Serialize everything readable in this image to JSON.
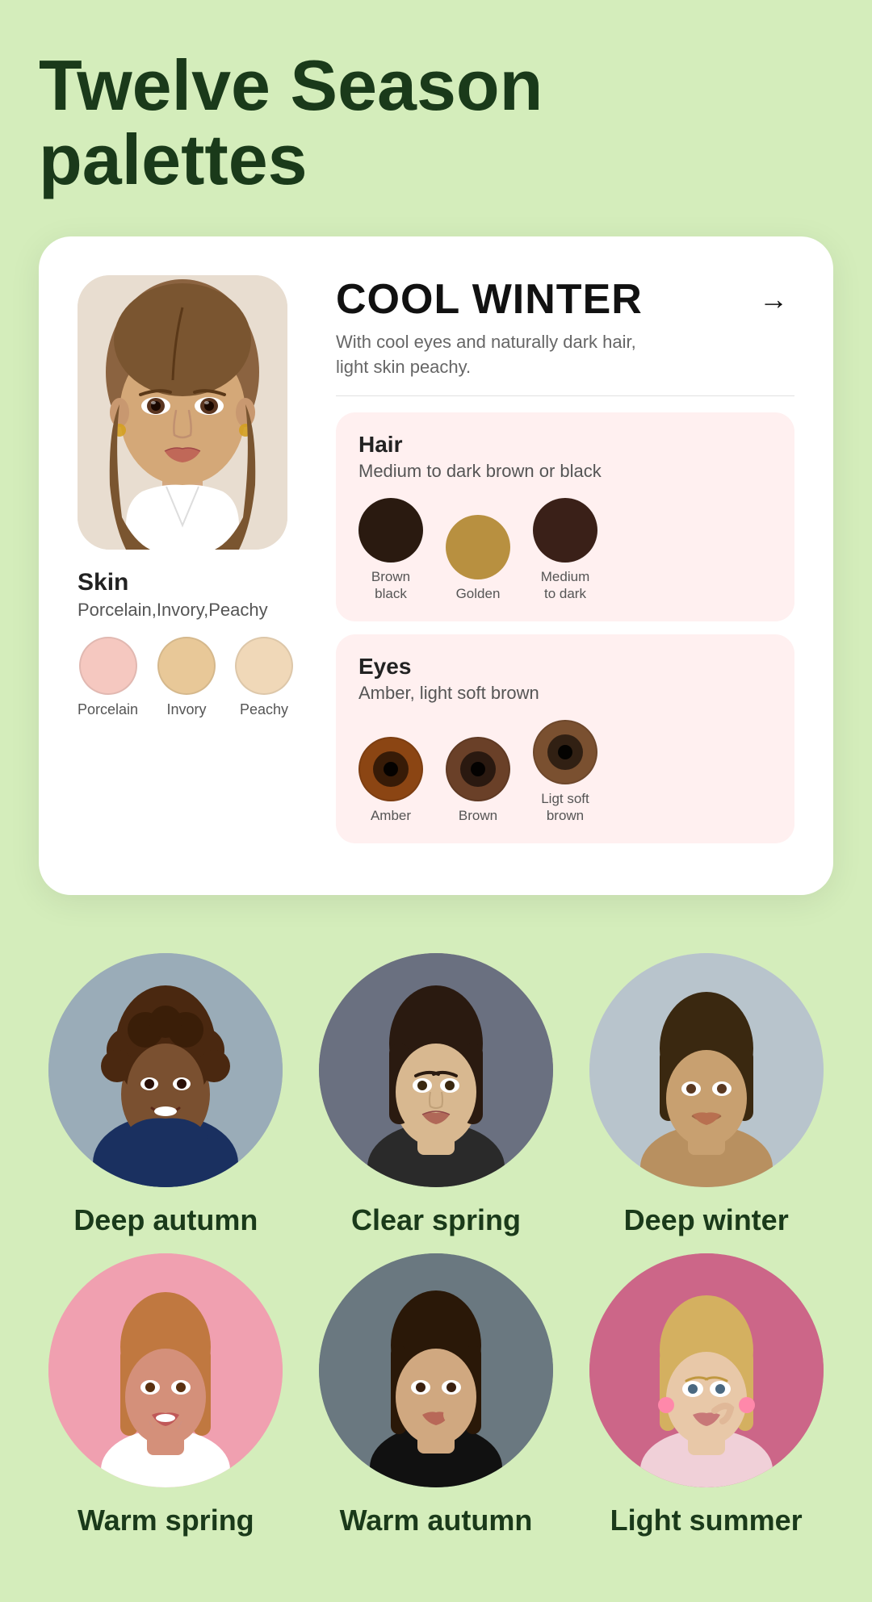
{
  "page": {
    "title": "Twelve Season\npalettes",
    "background": "#d4edbb"
  },
  "card": {
    "season_name": "COOL WINTER",
    "season_desc": "With cool eyes and naturally dark hair,\nlight skin peachy.",
    "arrow": "→",
    "skin": {
      "label": "Skin",
      "sub": "Porcelain,Invory,Peachy",
      "swatches": [
        {
          "name": "Porcelain",
          "color": "#f5c8c0"
        },
        {
          "name": "Invory",
          "color": "#e8c898"
        },
        {
          "name": "Peachy",
          "color": "#f0d8b8"
        }
      ]
    },
    "hair": {
      "label": "Hair",
      "sub": "Medium to dark brown or black",
      "swatches": [
        {
          "name": "Brown black",
          "color": "#2a1a10"
        },
        {
          "name": "Golden",
          "color": "#b89040"
        },
        {
          "name": "Medium\nto dark",
          "color": "#3a2018"
        }
      ]
    },
    "eyes": {
      "label": "Eyes",
      "sub": "Amber, light soft brown",
      "swatches": [
        {
          "name": "Amber",
          "color": "#8B4513"
        },
        {
          "name": "Brown",
          "color": "#5a3218"
        },
        {
          "name": "Ligt soft\nbrown",
          "color": "#7a5030"
        }
      ]
    }
  },
  "portraits_row1": [
    {
      "name": "Deep autumn",
      "bg": "#8a7060"
    },
    {
      "name": "Clear spring",
      "bg": "#707880"
    },
    {
      "name": "Deep winter",
      "bg": "#909898"
    }
  ],
  "portraits_row2": [
    {
      "name": "Warm spring",
      "bg": "#e89098"
    },
    {
      "name": "Warm autumn",
      "bg": "#707880"
    },
    {
      "name": "Light summer",
      "bg": "#cc6688"
    }
  ]
}
